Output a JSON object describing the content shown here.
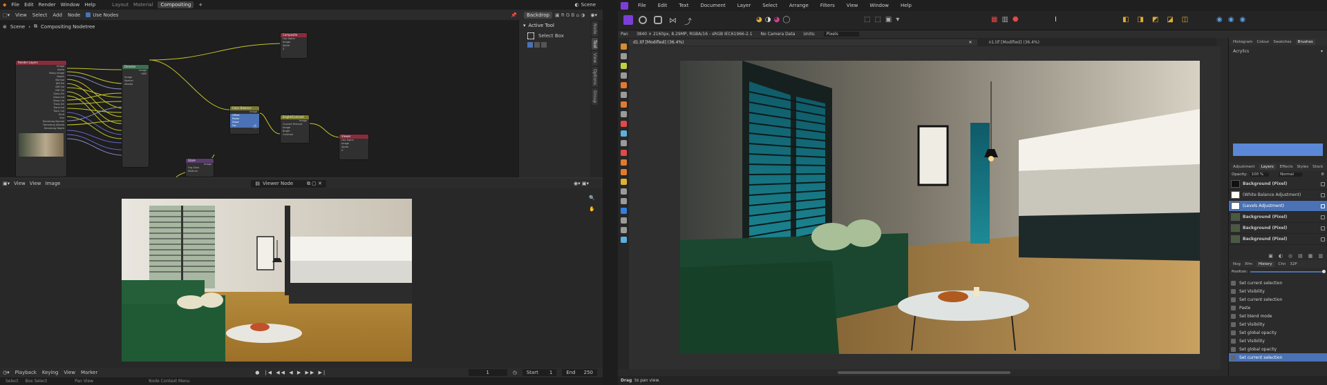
{
  "blender": {
    "menu": [
      "File",
      "Edit",
      "Render",
      "Window",
      "Help"
    ],
    "workspaces": [
      "Layout",
      "Material",
      "Compositing"
    ],
    "active_workspace": "Compositing",
    "scene": "Scene",
    "editor_menu": [
      "View",
      "Select",
      "Add",
      "Node"
    ],
    "use_nodes_label": "Use Nodes",
    "backdrop_label": "Backdrop",
    "breadcrumb": [
      "Scene",
      "Compositing Nodetree"
    ],
    "sidebar": {
      "section": "Active Tool",
      "tool": "Select Box"
    },
    "side_tabs": [
      "Node",
      "Tool",
      "View",
      "Options",
      "Group"
    ],
    "nodes": {
      "render_layers": {
        "title": "Render Layers",
        "rows": [
          "Image",
          "Alpha",
          "Noisy Image",
          "Depth",
          "Normal",
          "Diff Dir",
          "Diff Ind",
          "Diff Col",
          "Gloss Dir",
          "Gloss Ind",
          "Gloss Col",
          "Trans Dir",
          "Trans Ind",
          "Trans Col",
          "Emit",
          "Env",
          "Denoising Normal",
          "Denoising Albedo",
          "Denoising Depth"
        ]
      },
      "denoise": {
        "title": "Denoise",
        "rows": [
          "Image",
          "Normal",
          "Albedo",
          "HDR"
        ]
      },
      "composite": {
        "title": "Composite",
        "rows": [
          "Use Alpha",
          "Image",
          "Alpha",
          "Z"
        ]
      },
      "color_balance": {
        "title": "Color Balance",
        "rows": [
          "Image",
          "Offset",
          "Power",
          "Slope",
          "Fac"
        ]
      },
      "bright_contrast": {
        "title": "Bright/Contrast",
        "rows": [
          "Image",
          "Convert Premult",
          "Image",
          "Bright",
          "Contrast"
        ]
      },
      "viewer": {
        "title": "Viewer",
        "rows": [
          "Use Alpha",
          "Image",
          "Alpha",
          "Z"
        ]
      },
      "glare": {
        "title": "Glare",
        "rows": [
          "Image",
          "Fog Glow",
          "Medium"
        ]
      }
    },
    "viewer_header": {
      "menus": [
        "View",
        "View",
        "Image"
      ],
      "node_label": "Viewer Node"
    },
    "timeline": {
      "menus": [
        "Playback",
        "Keying",
        "View",
        "Marker"
      ],
      "frame": "1",
      "start_label": "Start",
      "start": "1",
      "end_label": "End",
      "end": "250"
    },
    "status": [
      "Select",
      "Box Select",
      "Pan View",
      "Node Context Menu"
    ]
  },
  "affinity": {
    "menu": [
      "File",
      "Edit",
      "Text",
      "Document",
      "Layer",
      "Select",
      "Arrange",
      "Filters",
      "View",
      "Window",
      "Help"
    ],
    "context": {
      "tool": "Pan",
      "info": "3840 × 2160px, 8.29MP, RGBA/16 - sRGB IEC61966-2.1",
      "camera": "No Camera Data",
      "units_label": "Units:",
      "units": "Pixels"
    },
    "tabs": [
      "d1.tif [Modified] (36.4%)",
      "n1.tif [Modified] (36.4%)"
    ],
    "panel_tabs_top": [
      "Histogram",
      "Colour",
      "Swatches",
      "Brushes"
    ],
    "brush_category": "Acrylics",
    "panel_tabs_mid": [
      "Adjustment",
      "Layers",
      "Effects",
      "Styles",
      "Stock"
    ],
    "opacity_label": "Opacity:",
    "opacity": "100 %",
    "blend": "Normal",
    "layers": [
      {
        "name": "Background (Pixel)",
        "selected": false
      },
      {
        "name": "(White Balance Adjustment)",
        "selected": false
      },
      {
        "name": "(Levels Adjustment)",
        "selected": true
      },
      {
        "name": "Background (Pixel)",
        "selected": false
      },
      {
        "name": "Background (Pixel)",
        "selected": false
      },
      {
        "name": "Background (Pixel)",
        "selected": false
      }
    ],
    "panel_tabs_bottom": [
      "Nvg",
      "Xfm",
      "History",
      "Chn",
      "32P"
    ],
    "position_label": "Position:",
    "history": [
      "Set current selection",
      "Set Visibility",
      "Set current selection",
      "Paste",
      "Set blend mode",
      "Set Visibility",
      "Set global opacity",
      "Set Visibility",
      "Set global opacity",
      "Set current selection"
    ],
    "history_selected_index": 9,
    "status_bold": "Drag",
    "status_text": "to pan view."
  }
}
